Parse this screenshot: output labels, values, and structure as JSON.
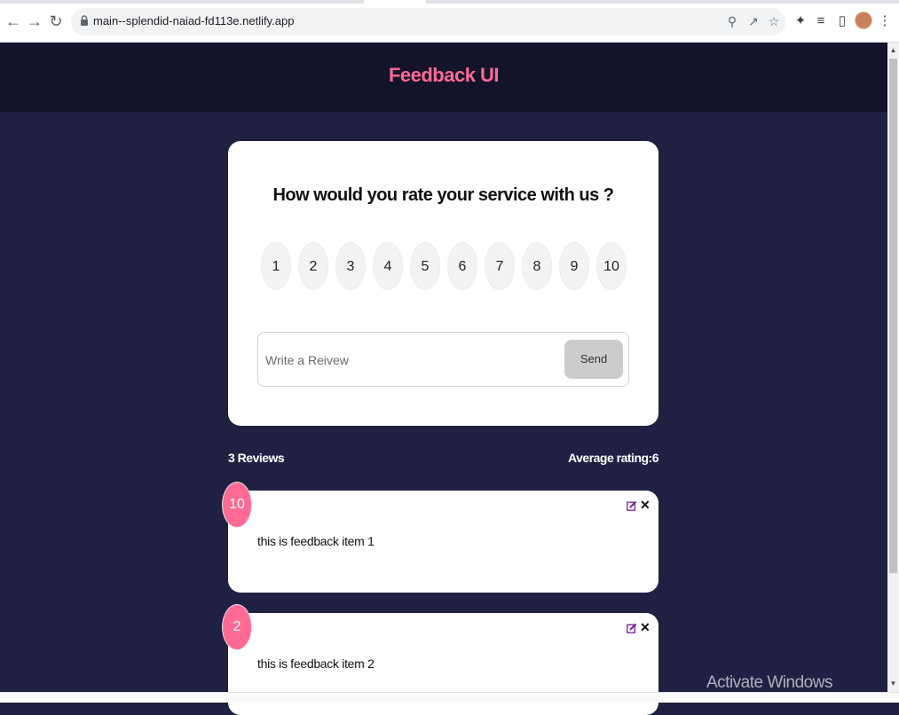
{
  "browser": {
    "url": "main--splendid-naiad-fd113e.netlify.app"
  },
  "header": {
    "title": "Feedback UI"
  },
  "rating_card": {
    "question": "How would you rate your service with us ?",
    "options": [
      "1",
      "2",
      "3",
      "4",
      "5",
      "6",
      "7",
      "8",
      "9",
      "10"
    ],
    "input_placeholder": "Write a Reivew",
    "send_label": "Send"
  },
  "stats": {
    "count_label": "3 Reviews",
    "average_label": "Average rating:6"
  },
  "feedback_items": [
    {
      "rating": "10",
      "text": "this is feedback item 1"
    },
    {
      "rating": "2",
      "text": "this is feedback item 2"
    }
  ],
  "os": {
    "watermark": "Activate Windows"
  },
  "colors": {
    "accent": "#ff6a95",
    "background": "#202142",
    "header_bg": "#13132a"
  }
}
